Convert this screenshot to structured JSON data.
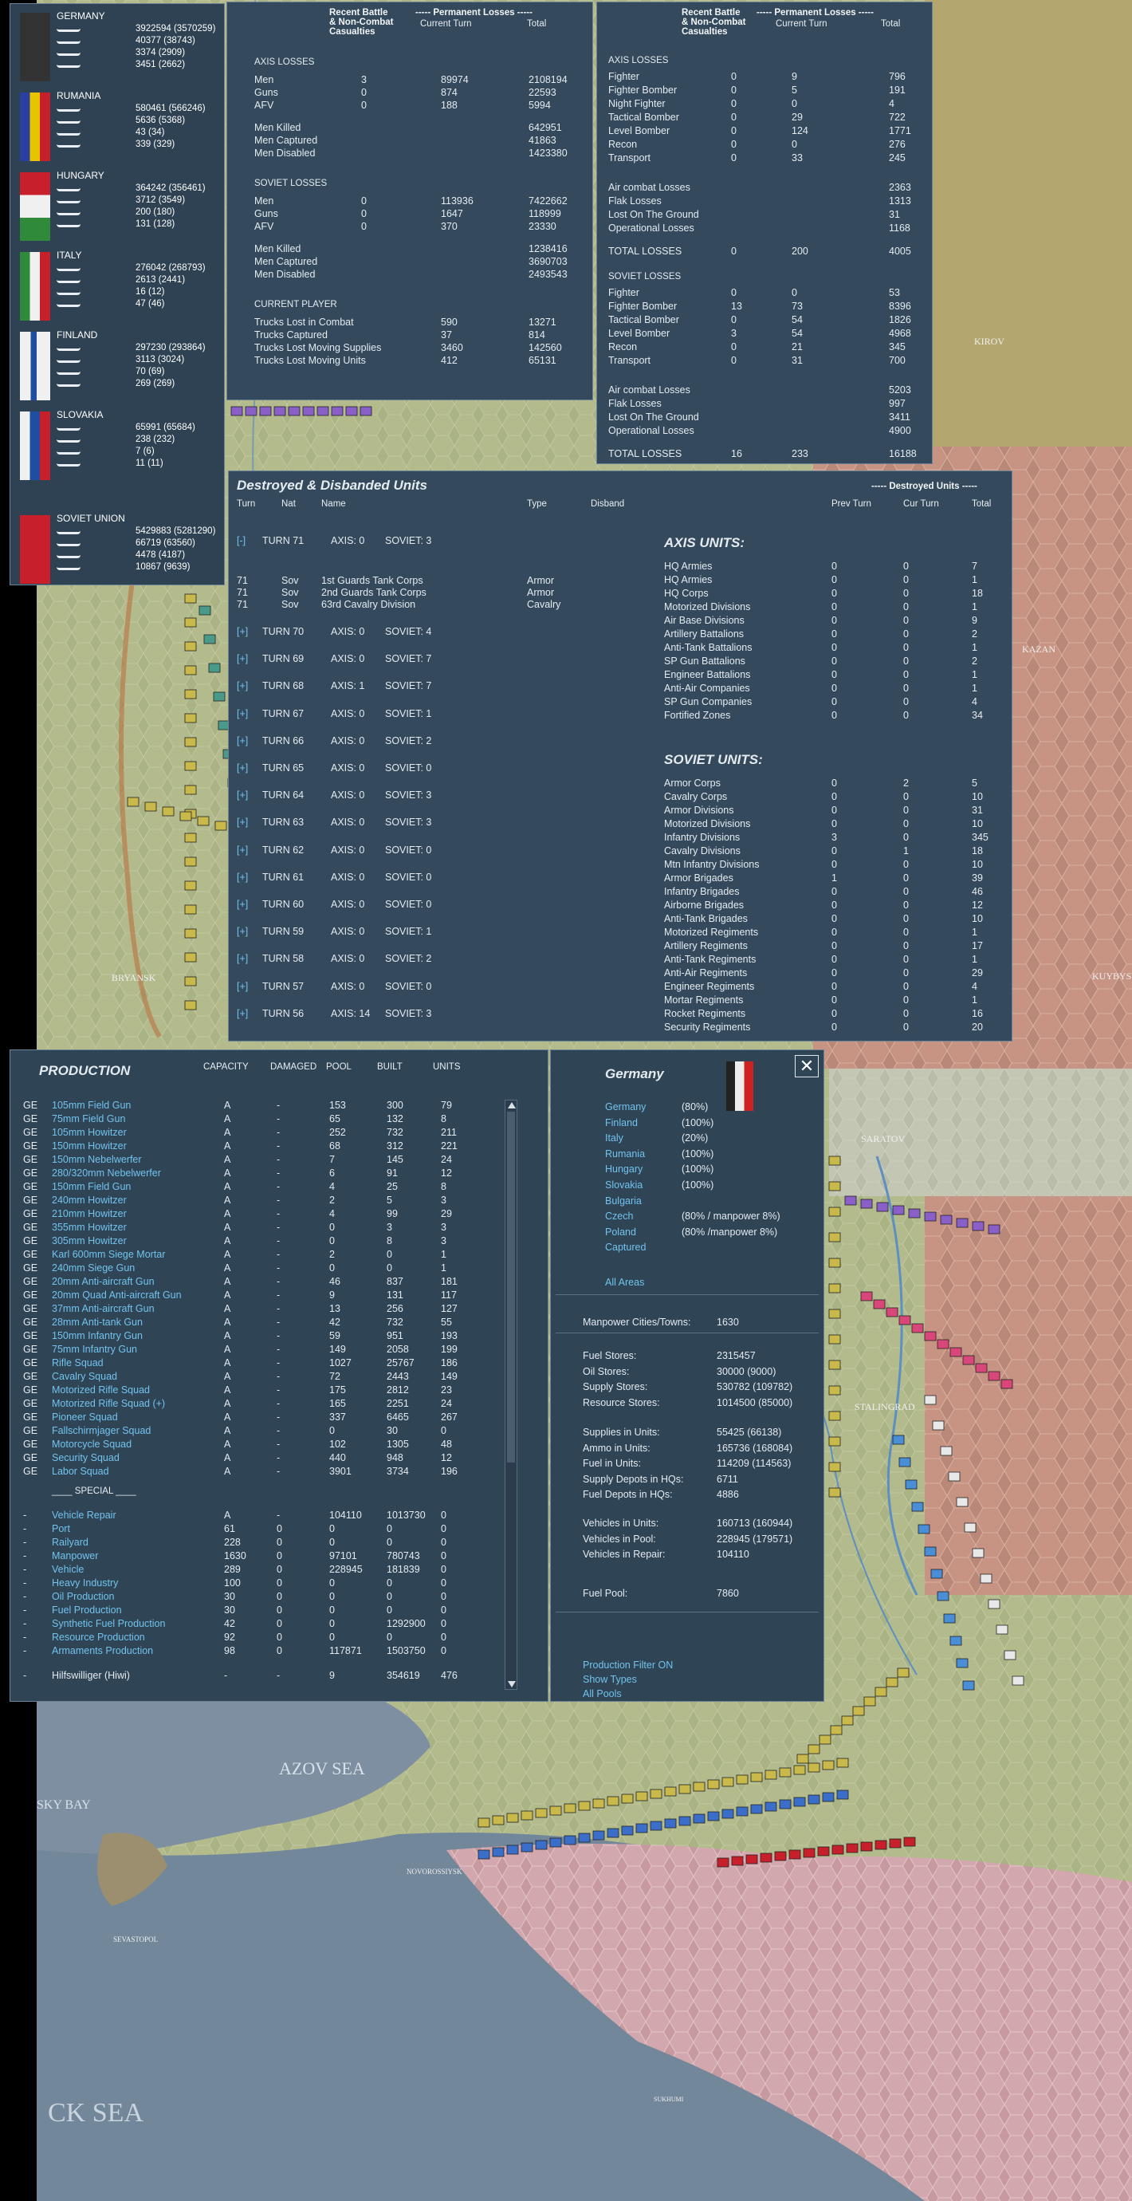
{
  "nations": [
    {
      "name": "GERMANY",
      "flag": "germany",
      "values": [
        "3922594 (3570259)",
        "40377 (38743)",
        "3374 (2909)",
        "3451 (2662)"
      ]
    },
    {
      "name": "RUMANIA",
      "flag": "rumania",
      "values": [
        "580461 (566246)",
        "5636 (5368)",
        "43 (34)",
        "339 (329)"
      ]
    },
    {
      "name": "HUNGARY",
      "flag": "hungary",
      "values": [
        "364242 (356461)",
        "3712 (3549)",
        "200 (180)",
        "131 (128)"
      ]
    },
    {
      "name": "ITALY",
      "flag": "italy",
      "values": [
        "276042 (268793)",
        "2613 (2441)",
        "16 (12)",
        "47 (46)"
      ]
    },
    {
      "name": "FINLAND",
      "flag": "finland",
      "values": [
        "297230 (293864)",
        "3113 (3024)",
        "70 (69)",
        "269 (269)"
      ]
    },
    {
      "name": "SLOVAKIA",
      "flag": "slovakia",
      "values": [
        "65991 (65684)",
        "238 (232)",
        "7 (6)",
        "11 (11)"
      ]
    },
    {
      "name": "SOVIET UNION",
      "flag": "soviet",
      "values": [
        "5429883 (5281290)",
        "66719 (63560)",
        "4478 (4187)",
        "10867 (9639)"
      ]
    }
  ],
  "ground_losses": {
    "col_recent": [
      "Recent Battle",
      "& Non-Combat",
      "Casualties"
    ],
    "col_perm": "----- Permanent Losses -----",
    "col_cur": "Current Turn",
    "col_total": "Total",
    "axis_title": "AXIS LOSSES",
    "axis": [
      [
        "Men",
        "3",
        "89974",
        "2108194"
      ],
      [
        "Guns",
        "0",
        "874",
        "22593"
      ],
      [
        "AFV",
        "0",
        "188",
        "5994"
      ]
    ],
    "axis2": [
      [
        "Men Killed",
        "642951"
      ],
      [
        "Men Captured",
        "41863"
      ],
      [
        "Men Disabled",
        "1423380"
      ]
    ],
    "soviet_title": "SOVIET LOSSES",
    "soviet": [
      [
        "Men",
        "0",
        "113936",
        "7422662"
      ],
      [
        "Guns",
        "0",
        "1647",
        "118999"
      ],
      [
        "AFV",
        "0",
        "370",
        "23330"
      ]
    ],
    "soviet2": [
      [
        "Men Killed",
        "1238416"
      ],
      [
        "Men Captured",
        "3690703"
      ],
      [
        "Men Disabled",
        "2493543"
      ]
    ],
    "player_title": "CURRENT PLAYER",
    "player": [
      [
        "Trucks Lost in Combat",
        "590",
        "13271"
      ],
      [
        "Trucks Captured",
        "37",
        "814"
      ],
      [
        "Trucks Lost Moving Supplies",
        "3460",
        "142560"
      ],
      [
        "Trucks Lost Moving Units",
        "412",
        "65131"
      ]
    ]
  },
  "air_losses": {
    "col_recent": [
      "Recent Battle",
      "& Non-Combat",
      "Casualties"
    ],
    "col_perm": "----- Permanent Losses -----",
    "col_cur": "Current Turn",
    "col_total": "Total",
    "axis_title": "AXIS LOSSES",
    "axis": [
      [
        "Fighter",
        "0",
        "9",
        "796"
      ],
      [
        "Fighter Bomber",
        "0",
        "5",
        "191"
      ],
      [
        "Night Fighter",
        "0",
        "0",
        "4"
      ],
      [
        "Tactical Bomber",
        "0",
        "29",
        "722"
      ],
      [
        "Level Bomber",
        "0",
        "124",
        "1771"
      ],
      [
        "Recon",
        "0",
        "0",
        "276"
      ],
      [
        "Transport",
        "0",
        "33",
        "245"
      ]
    ],
    "axis2": [
      [
        "Air combat Losses",
        "2363"
      ],
      [
        "Flak Losses",
        "1313"
      ],
      [
        "Lost On The Ground",
        "31"
      ],
      [
        "Operational Losses",
        "1168"
      ]
    ],
    "axis_total": [
      "TOTAL LOSSES",
      "0",
      "200",
      "4005"
    ],
    "soviet_title": "SOVIET LOSSES",
    "soviet": [
      [
        "Fighter",
        "0",
        "0",
        "53"
      ],
      [
        "Fighter Bomber",
        "13",
        "73",
        "8396"
      ],
      [
        "Tactical Bomber",
        "0",
        "54",
        "1826"
      ],
      [
        "Level Bomber",
        "3",
        "54",
        "4968"
      ],
      [
        "Recon",
        "0",
        "21",
        "345"
      ],
      [
        "Transport",
        "0",
        "31",
        "700"
      ]
    ],
    "soviet2": [
      [
        "Air combat Losses",
        "5203"
      ],
      [
        "Flak Losses",
        "997"
      ],
      [
        "Lost On The Ground",
        "3411"
      ],
      [
        "Operational Losses",
        "4900"
      ]
    ],
    "soviet_total": [
      "TOTAL LOSSES",
      "16",
      "233",
      "16188"
    ]
  },
  "destroyed": {
    "title": "Destroyed & Disbanded Units",
    "range_label": "----- Destroyed Units -----",
    "cols": [
      "Turn",
      "Nat",
      "Name",
      "Type",
      "Disband",
      "Prev Turn",
      "Cur Turn",
      "Total"
    ],
    "turn71": {
      "toggle": "[-]",
      "label": "TURN 71",
      "axis": "AXIS: 0",
      "soviet": "SOVIET: 3"
    },
    "units": [
      [
        "71",
        "Sov",
        "1st Guards Tank Corps",
        "Armor"
      ],
      [
        "71",
        "Sov",
        "2nd Guards Tank Corps",
        "Armor"
      ],
      [
        "71",
        "Sov",
        "63rd Cavalry Division",
        "Cavalry"
      ]
    ],
    "turns": [
      [
        "TURN 70",
        "AXIS: 0",
        "SOVIET: 4"
      ],
      [
        "TURN 69",
        "AXIS: 0",
        "SOVIET: 7"
      ],
      [
        "TURN 68",
        "AXIS: 1",
        "SOVIET: 7"
      ],
      [
        "TURN 67",
        "AXIS: 0",
        "SOVIET: 1"
      ],
      [
        "TURN 66",
        "AXIS: 0",
        "SOVIET: 2"
      ],
      [
        "TURN 65",
        "AXIS: 0",
        "SOVIET: 0"
      ],
      [
        "TURN 64",
        "AXIS: 0",
        "SOVIET: 3"
      ],
      [
        "TURN 63",
        "AXIS: 0",
        "SOVIET: 3"
      ],
      [
        "TURN 62",
        "AXIS: 0",
        "SOVIET: 0"
      ],
      [
        "TURN 61",
        "AXIS: 0",
        "SOVIET: 0"
      ],
      [
        "TURN 60",
        "AXIS: 0",
        "SOVIET: 0"
      ],
      [
        "TURN 59",
        "AXIS: 0",
        "SOVIET: 1"
      ],
      [
        "TURN 58",
        "AXIS: 0",
        "SOVIET: 2"
      ],
      [
        "TURN 57",
        "AXIS: 0",
        "SOVIET: 0"
      ],
      [
        "TURN 56",
        "AXIS: 14",
        "SOVIET: 3"
      ]
    ],
    "axis_title": "AXIS UNITS:",
    "axis_units": [
      [
        "HQ Armies",
        "0",
        "0",
        "7"
      ],
      [
        "HQ Armies",
        "0",
        "0",
        "1"
      ],
      [
        "HQ Corps",
        "0",
        "0",
        "18"
      ],
      [
        "Motorized Divisions",
        "0",
        "0",
        "1"
      ],
      [
        "Air Base Divisions",
        "0",
        "0",
        "9"
      ],
      [
        "Artillery Battalions",
        "0",
        "0",
        "2"
      ],
      [
        "Anti-Tank Battalions",
        "0",
        "0",
        "1"
      ],
      [
        "SP Gun Battalions",
        "0",
        "0",
        "2"
      ],
      [
        "Engineer Battalions",
        "0",
        "0",
        "1"
      ],
      [
        "Anti-Air Companies",
        "0",
        "0",
        "1"
      ],
      [
        "SP Gun Companies",
        "0",
        "0",
        "4"
      ],
      [
        "Fortified Zones",
        "0",
        "0",
        "34"
      ]
    ],
    "soviet_title": "SOVIET UNITS:",
    "soviet_units": [
      [
        "Armor Corps",
        "0",
        "2",
        "5"
      ],
      [
        "Cavalry Corps",
        "0",
        "0",
        "10"
      ],
      [
        "Armor Divisions",
        "0",
        "0",
        "31"
      ],
      [
        "Motorized Divisions",
        "0",
        "0",
        "10"
      ],
      [
        "Infantry Divisions",
        "3",
        "0",
        "345"
      ],
      [
        "Cavalry Divisions",
        "0",
        "1",
        "18"
      ],
      [
        "Mtn Infantry Divisions",
        "0",
        "0",
        "10"
      ],
      [
        "Armor Brigades",
        "1",
        "0",
        "39"
      ],
      [
        "Infantry Brigades",
        "0",
        "0",
        "46"
      ],
      [
        "Airborne Brigades",
        "0",
        "0",
        "12"
      ],
      [
        "Anti-Tank Brigades",
        "0",
        "0",
        "10"
      ],
      [
        "Motorized Regiments",
        "0",
        "0",
        "1"
      ],
      [
        "Artillery Regiments",
        "0",
        "0",
        "17"
      ],
      [
        "Anti-Tank Regiments",
        "0",
        "0",
        "1"
      ],
      [
        "Anti-Air Regiments",
        "0",
        "0",
        "29"
      ],
      [
        "Engineer Regiments",
        "0",
        "0",
        "4"
      ],
      [
        "Mortar Regiments",
        "0",
        "0",
        "1"
      ],
      [
        "Rocket Regiments",
        "0",
        "0",
        "16"
      ],
      [
        "Security Regiments",
        "0",
        "0",
        "20"
      ]
    ]
  },
  "production": {
    "title": "PRODUCTION",
    "cols": [
      "CAPACITY",
      "DAMAGED",
      "POOL",
      "BUILT",
      "UNITS"
    ],
    "rows": [
      [
        "GE",
        "105mm Field Gun",
        "A",
        "-",
        "153",
        "300",
        "79"
      ],
      [
        "GE",
        "75mm Field Gun",
        "A",
        "-",
        "65",
        "132",
        "8"
      ],
      [
        "GE",
        "105mm Howitzer",
        "A",
        "-",
        "252",
        "732",
        "211"
      ],
      [
        "GE",
        "150mm Howitzer",
        "A",
        "-",
        "68",
        "312",
        "221"
      ],
      [
        "GE",
        "150mm Nebelwerfer",
        "A",
        "-",
        "7",
        "145",
        "24"
      ],
      [
        "GE",
        "280/320mm Nebelwerfer",
        "A",
        "-",
        "6",
        "91",
        "12"
      ],
      [
        "GE",
        "150mm Field Gun",
        "A",
        "-",
        "4",
        "25",
        "8"
      ],
      [
        "GE",
        "240mm Howitzer",
        "A",
        "-",
        "2",
        "5",
        "3"
      ],
      [
        "GE",
        "210mm Howitzer",
        "A",
        "-",
        "4",
        "99",
        "29"
      ],
      [
        "GE",
        "355mm Howitzer",
        "A",
        "-",
        "0",
        "3",
        "3"
      ],
      [
        "GE",
        "305mm Howitzer",
        "A",
        "-",
        "0",
        "8",
        "3"
      ],
      [
        "GE",
        "Karl 600mm Siege Mortar",
        "A",
        "-",
        "2",
        "0",
        "1"
      ],
      [
        "GE",
        "240mm Siege Gun",
        "A",
        "-",
        "0",
        "0",
        "1"
      ],
      [
        "GE",
        "20mm Anti-aircraft Gun",
        "A",
        "-",
        "46",
        "837",
        "181"
      ],
      [
        "GE",
        "20mm Quad Anti-aircraft Gun",
        "A",
        "-",
        "9",
        "131",
        "117"
      ],
      [
        "GE",
        "37mm Anti-aircraft Gun",
        "A",
        "-",
        "13",
        "256",
        "127"
      ],
      [
        "GE",
        "28mm Anti-tank Gun",
        "A",
        "-",
        "42",
        "732",
        "55"
      ],
      [
        "GE",
        "150mm Infantry Gun",
        "A",
        "-",
        "59",
        "951",
        "193"
      ],
      [
        "GE",
        "75mm Infantry Gun",
        "A",
        "-",
        "149",
        "2058",
        "199"
      ],
      [
        "GE",
        "Rifle Squad",
        "A",
        "-",
        "1027",
        "25767",
        "186"
      ],
      [
        "GE",
        "Cavalry Squad",
        "A",
        "-",
        "72",
        "2443",
        "149"
      ],
      [
        "GE",
        "Motorized Rifle Squad",
        "A",
        "-",
        "175",
        "2812",
        "23"
      ],
      [
        "GE",
        "Motorized Rifle Squad (+)",
        "A",
        "-",
        "165",
        "2251",
        "24"
      ],
      [
        "GE",
        "Pioneer Squad",
        "A",
        "-",
        "337",
        "6465",
        "267"
      ],
      [
        "GE",
        "Fallschirmjager Squad",
        "A",
        "-",
        "0",
        "30",
        "0"
      ],
      [
        "GE",
        "Motorcycle Squad",
        "A",
        "-",
        "102",
        "1305",
        "48"
      ],
      [
        "GE",
        "Security Squad",
        "A",
        "-",
        "440",
        "948",
        "12"
      ],
      [
        "GE",
        "Labor Squad",
        "A",
        "-",
        "3901",
        "3734",
        "196"
      ]
    ],
    "special": "____ SPECIAL ____",
    "special_rows": [
      [
        "-",
        "Vehicle Repair",
        "A",
        "-",
        "104110",
        "1013730",
        "0"
      ],
      [
        "-",
        "Port",
        "61",
        "0",
        "0",
        "0",
        "0"
      ],
      [
        "-",
        "Railyard",
        "228",
        "0",
        "0",
        "0",
        "0"
      ],
      [
        "-",
        "Manpower",
        "1630",
        "0",
        "97101",
        "780743",
        "0"
      ],
      [
        "-",
        "Vehicle",
        "289",
        "0",
        "228945",
        "181839",
        "0"
      ],
      [
        "-",
        "Heavy Industry",
        "100",
        "0",
        "0",
        "0",
        "0"
      ],
      [
        "-",
        "Oil Production",
        "30",
        "0",
        "0",
        "0",
        "0"
      ],
      [
        "-",
        "Fuel Production",
        "30",
        "0",
        "0",
        "0",
        "0"
      ],
      [
        "-",
        "Synthetic Fuel Production",
        "42",
        "0",
        "0",
        "1292900",
        "0"
      ],
      [
        "-",
        "Resource Production",
        "92",
        "0",
        "0",
        "0",
        "0"
      ],
      [
        "-",
        "Armaments Production",
        "98",
        "0",
        "117871",
        "1503750",
        "0"
      ]
    ],
    "last_row": [
      "-",
      "Hilfswilliger (Hiwi)",
      "-",
      "-",
      "9",
      "354619",
      "476"
    ]
  },
  "germany_panel": {
    "title": "Germany",
    "nations": [
      [
        "Germany",
        "(80%)"
      ],
      [
        "Finland",
        "(100%)"
      ],
      [
        "Italy",
        "(20%)"
      ],
      [
        "Rumania",
        "(100%)"
      ],
      [
        "Hungary",
        "(100%)"
      ],
      [
        "Slovakia",
        "(100%)"
      ],
      [
        "Bulgaria",
        ""
      ],
      [
        "Czech",
        "(80% / manpower 8%)"
      ],
      [
        "Poland",
        "(80% /manpower 8%)"
      ],
      [
        "Captured",
        ""
      ]
    ],
    "all_areas": "All Areas",
    "manpower": [
      "Manpower Cities/Towns:",
      "1630"
    ],
    "stores": [
      [
        "Fuel Stores:",
        "2315457"
      ],
      [
        "Oil Stores:",
        "30000 (9000)"
      ],
      [
        "Supply Stores:",
        "530782 (109782)"
      ],
      [
        "Resource Stores:",
        "1014500 (85000)"
      ]
    ],
    "supplies": [
      [
        "Supplies in Units:",
        "55425 (66138)"
      ],
      [
        "Ammo in Units:",
        "165736 (168084)"
      ],
      [
        "Fuel in Units:",
        "114209 (114563)"
      ],
      [
        "Supply Depots in HQs:",
        "6711"
      ],
      [
        "Fuel Depots in HQs:",
        "4886"
      ]
    ],
    "vehicles": [
      [
        "Vehicles in Units:",
        "160713 (160944)"
      ],
      [
        "Vehicles in Pool:",
        "228945 (179571)"
      ],
      [
        "Vehicles in Repair:",
        "104110"
      ]
    ],
    "fuel_pool": [
      "Fuel Pool:",
      "7860"
    ],
    "links": [
      "Production Filter ON",
      "Show Types",
      "All Pools"
    ],
    "close": "✕"
  },
  "map_labels": [
    "KIROV",
    "KAZAN",
    "KUYBYSHEV",
    "BRYANSK",
    "SARATOV",
    "STALINGRAD",
    "AZOV SEA",
    "SKY BAY",
    "NOVOROSSIYSK",
    "SEVASTOPOL",
    "CK SEA",
    "SUKHUMI"
  ]
}
